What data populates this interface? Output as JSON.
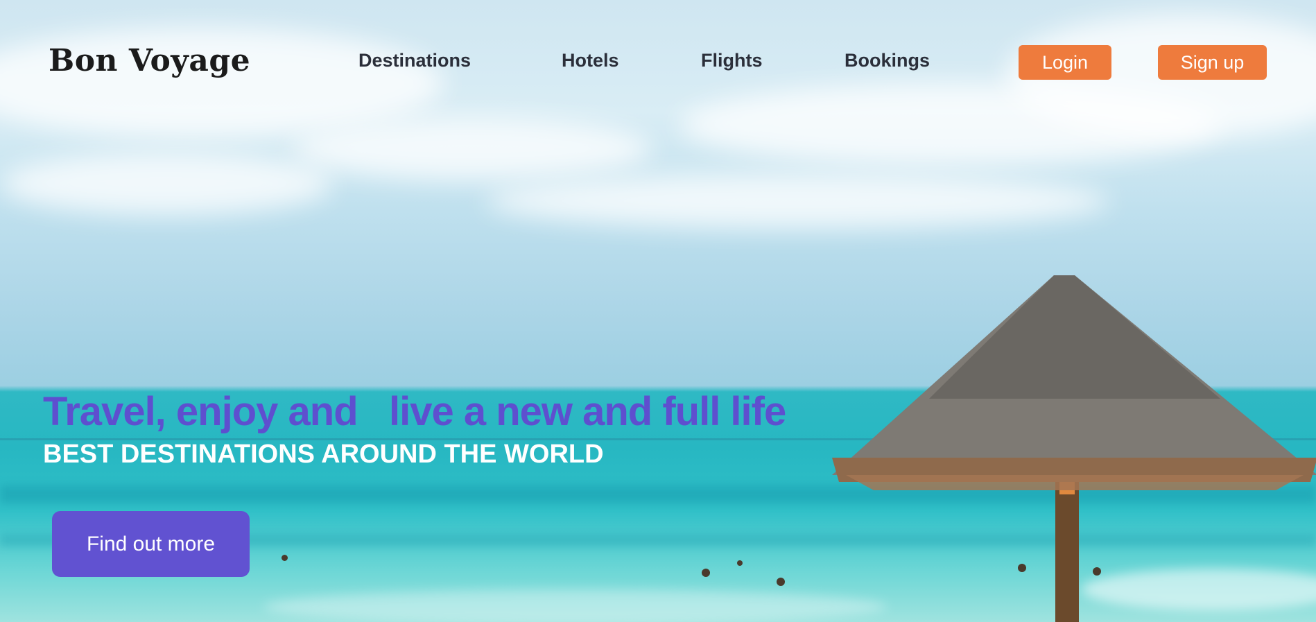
{
  "header": {
    "logo": "Bon Voyage",
    "nav": [
      "Destinations",
      "Hotels",
      "Flights",
      "Bookings"
    ],
    "login_label": "Login",
    "signup_label": "Sign up"
  },
  "hero": {
    "headline": "Travel, enjoy and   live a new and full life",
    "subheadline": "BEST DESTINATIONS AROUND THE WORLD",
    "cta_label": "Find out more"
  },
  "colors": {
    "accent_purple": "#5e4fcf",
    "button_orange": "#ee7b3d",
    "nav_text": "#2b2f3a"
  }
}
